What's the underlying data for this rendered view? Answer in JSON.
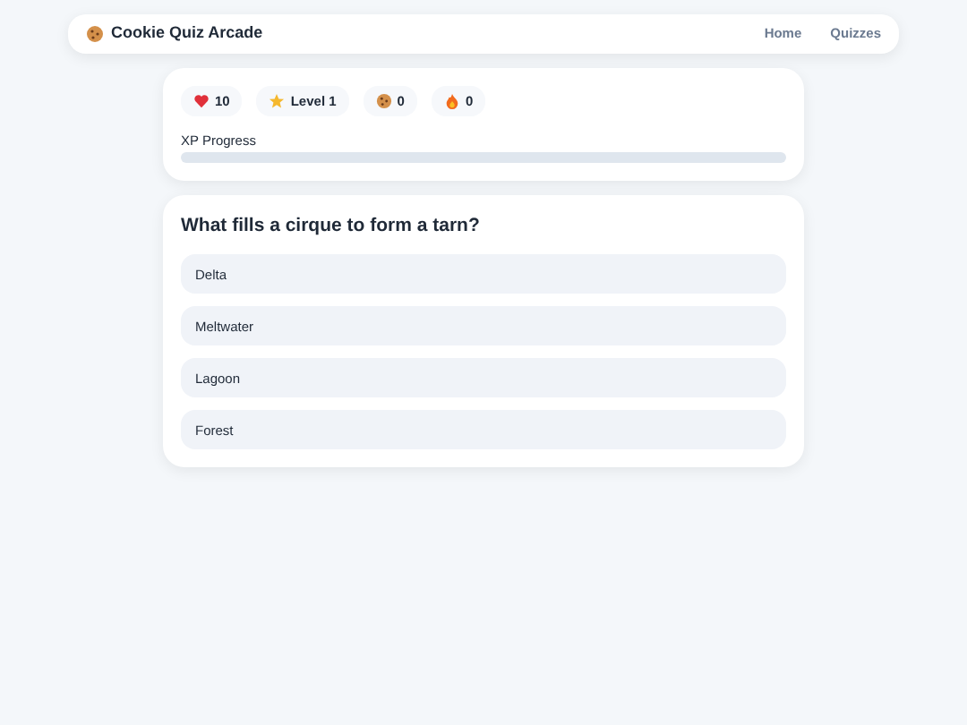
{
  "navbar": {
    "brand": "Cookie Quiz Arcade",
    "links": [
      {
        "label": "Home"
      },
      {
        "label": "Quizzes"
      }
    ]
  },
  "stats": [
    {
      "kind": "lives",
      "value": "10"
    },
    {
      "kind": "level",
      "value": "Level 1"
    },
    {
      "kind": "cookies",
      "value": "0"
    },
    {
      "kind": "streak",
      "value": "0"
    }
  ],
  "xp": {
    "label": "XP Progress",
    "level": 0
  },
  "question": {
    "text": "What fills a cirque to form a tarn?",
    "answers": [
      {
        "label": "Delta"
      },
      {
        "label": "Meltwater"
      },
      {
        "label": "Lagoon"
      },
      {
        "label": "Forest"
      }
    ]
  }
}
